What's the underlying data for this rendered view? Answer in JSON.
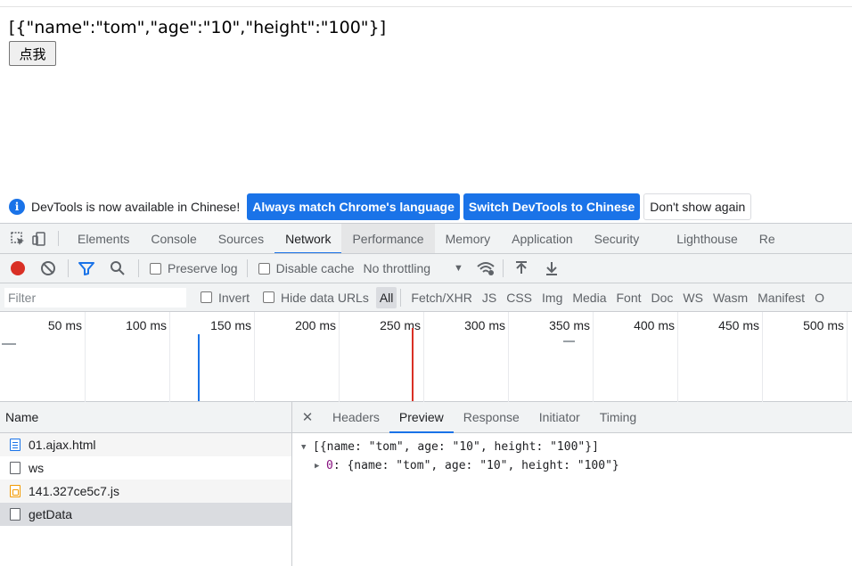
{
  "page": {
    "json_text": "[{\"name\":\"tom\",\"age\":\"10\",\"height\":\"100\"}]",
    "button_label": "点我"
  },
  "infobar": {
    "message": "DevTools is now available in Chinese!",
    "btn_match": "Always match Chrome's language",
    "btn_switch": "Switch DevTools to Chinese",
    "btn_dismiss": "Don't show again"
  },
  "tabs": [
    "Elements",
    "Console",
    "Sources",
    "Network",
    "Performance",
    "Memory",
    "Application",
    "Security",
    "Lighthouse",
    "Re"
  ],
  "toolbar": {
    "preserve_log": "Preserve log",
    "disable_cache": "Disable cache",
    "throttling": "No throttling"
  },
  "filter": {
    "placeholder": "Filter",
    "invert": "Invert",
    "hide_data_urls": "Hide data URLs",
    "types": [
      "All",
      "Fetch/XHR",
      "JS",
      "CSS",
      "Img",
      "Media",
      "Font",
      "Doc",
      "WS",
      "Wasm",
      "Manifest",
      "O"
    ]
  },
  "timeline": {
    "labels": [
      "50 ms",
      "100 ms",
      "150 ms",
      "200 ms",
      "250 ms",
      "300 ms",
      "350 ms",
      "400 ms",
      "450 ms",
      "500 ms"
    ]
  },
  "requests": {
    "header": "Name",
    "rows": [
      {
        "name": "01.ajax.html",
        "type": "doc"
      },
      {
        "name": "ws",
        "type": "other"
      },
      {
        "name": "141.327ce5c7.js",
        "type": "js"
      },
      {
        "name": "getData",
        "type": "other"
      }
    ]
  },
  "detail": {
    "tabs": [
      "Headers",
      "Preview",
      "Response",
      "Initiator",
      "Timing"
    ],
    "preview_root": "[{name: \"tom\", age: \"10\", height: \"100\"}]",
    "preview_child_index": "0",
    "preview_child_value": ": {name: \"tom\", age: \"10\", height: \"100\"}"
  },
  "colors": {
    "accent": "#1a73e8",
    "record": "#d93025"
  }
}
